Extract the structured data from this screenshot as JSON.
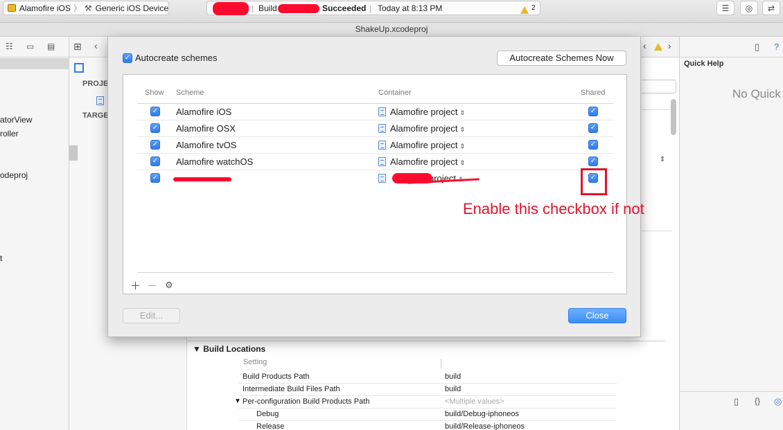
{
  "toolbar": {
    "scheme": "Alamofire iOS",
    "device": "Generic iOS Device",
    "build_label": "Build",
    "build_result": "Succeeded",
    "timestamp": "Today at 8:13 PM",
    "warning_count": "2"
  },
  "window_title": "ShakeUp.xcodeproj",
  "navigator": {
    "items": [
      "atorView",
      "roller",
      "odeproj",
      "t"
    ]
  },
  "project_editor": {
    "project_label": "PROJE",
    "targets_label": "TARGE"
  },
  "build_locations": {
    "section_title": "Build Locations",
    "setting_header": "Setting",
    "rows": [
      {
        "name": "Build Products Path",
        "value": "build"
      },
      {
        "name": "Intermediate Build Files Path",
        "value": "build"
      },
      {
        "name": "Per-configuration Build Products Path",
        "value": "<Multiple values>"
      },
      {
        "name": "Debug",
        "value": "build/Debug-iphoneos"
      },
      {
        "name": "Release",
        "value": "build/Release-iphoneos"
      }
    ]
  },
  "inspector": {
    "title": "Quick Help",
    "empty_text": "No Quick"
  },
  "sheet": {
    "autocreate_label": "Autocreate schemes",
    "autocreate_now_label": "Autocreate Schemes Now",
    "columns": {
      "show": "Show",
      "scheme": "Scheme",
      "container": "Container",
      "shared": "Shared"
    },
    "rows": [
      {
        "scheme": "Alamofire iOS",
        "container": "Alamofire project"
      },
      {
        "scheme": "Alamofire OSX",
        "container": "Alamofire project"
      },
      {
        "scheme": "Alamofire tvOS",
        "container": "Alamofire project"
      },
      {
        "scheme": "Alamofire watchOS",
        "container": "Alamofire project"
      },
      {
        "scheme": "",
        "container": "project"
      }
    ],
    "edit_label": "Edit...",
    "close_label": "Close"
  },
  "annotation": "Enable this checkbox if not",
  "colors": {
    "accent": "#3a8ef5",
    "annotation": "#e0142e",
    "warning": "#e8b923"
  }
}
